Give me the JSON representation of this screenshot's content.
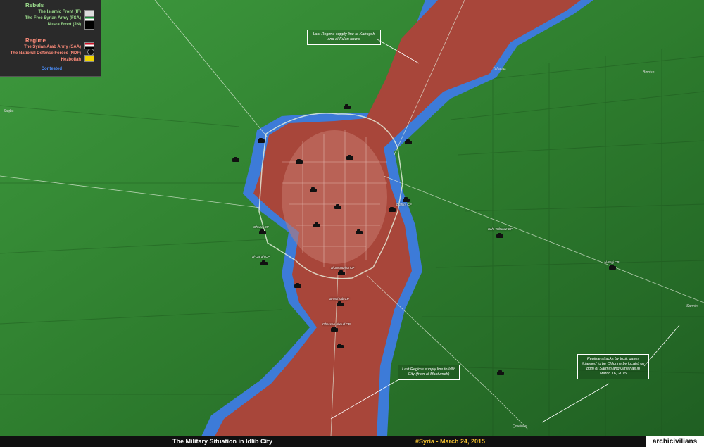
{
  "legend": {
    "rebels_heading": "Rebels",
    "rebels_items": [
      "The Islamic Front (IF)",
      "The Free Syrian Army (FSA)",
      "Nusra Front (JN)"
    ],
    "regime_heading": "Regime",
    "regime_items": [
      "The Syrian Arab Army (SAA)",
      "The National Defense Forces (NDF)",
      "Hezbollah"
    ],
    "contested": "Contested"
  },
  "colors": {
    "rebels": "#2e8b2e",
    "regime": "#a8463a",
    "contested": "#3d7bd8"
  },
  "callouts": {
    "north": "Last Regime supply line to Kafrayah and al-Fu'an towns",
    "south": "Last Regime supply line to Idlib City (from al-Mastumeh)",
    "east": "Regime attacks by toxic gases (claimed to be Chlorine by locals) on both of Sarmin and Qmeinas in March 16, 2015"
  },
  "towns": [
    "Binnish",
    "Sarmin",
    "Qmeinas",
    "Taftanaz",
    "Saqba"
  ],
  "checkpoints": [
    "al-Qal'ah CP",
    "Ibrahim CP",
    "al-Mahrab CP",
    "Sahl Taftanaz CP",
    "al-Sayj CP",
    "Ghwan CP",
    "al-Jumhuriya CP",
    "Ghassan Aboud CP"
  ],
  "bottom": {
    "title": "The Military Situation in Idlib City",
    "date": "#Syria  -  March 24, 2015",
    "watermark": "archicivilians"
  }
}
